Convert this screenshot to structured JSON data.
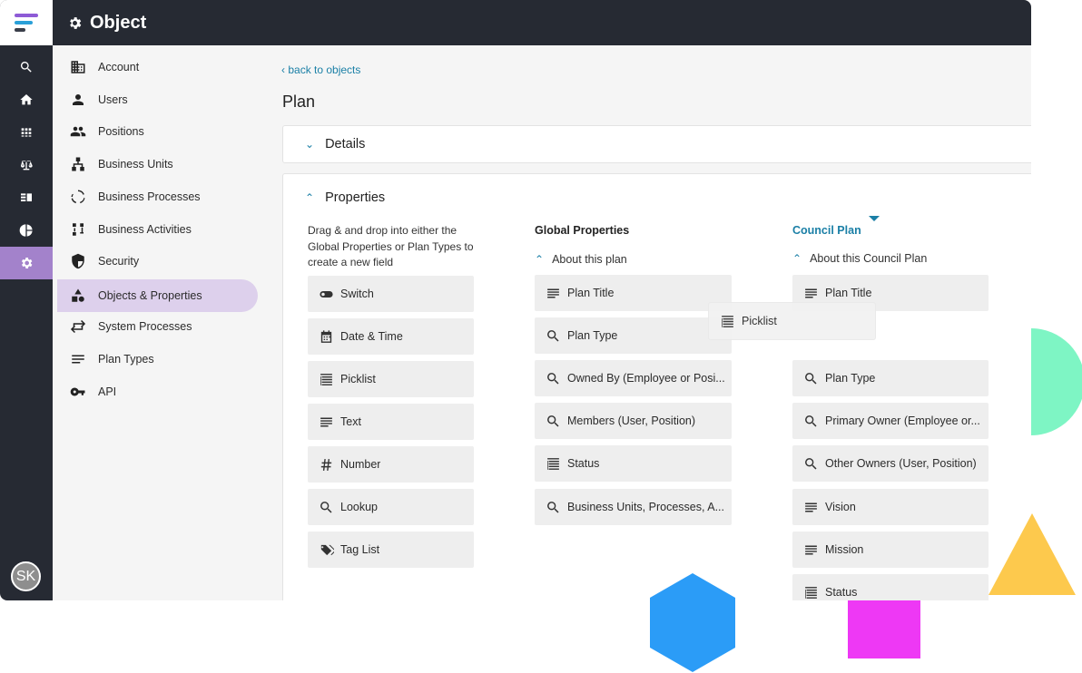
{
  "app": {
    "title": "Object",
    "user_initials": "SK"
  },
  "rail": [
    "search-icon",
    "home-icon",
    "grid-icon",
    "scale-icon",
    "board-icon",
    "pie-icon",
    "gear-icon"
  ],
  "sidebar": {
    "items": [
      {
        "label": "Account",
        "icon": "building-icon"
      },
      {
        "label": "Users",
        "icon": "user-icon"
      },
      {
        "label": "Positions",
        "icon": "people-icon"
      },
      {
        "label": "Business Units",
        "icon": "hierarchy-icon"
      },
      {
        "label": "Business Processes",
        "icon": "cycle-icon"
      },
      {
        "label": "Business Activities",
        "icon": "activities-icon"
      },
      {
        "label": "Security",
        "icon": "shield-icon"
      },
      {
        "label": "Objects & Properties",
        "icon": "shapes-icon",
        "active": true
      },
      {
        "label": "System Processes",
        "icon": "swap-icon"
      },
      {
        "label": "Plan Types",
        "icon": "lines-icon"
      },
      {
        "label": "API",
        "icon": "key-icon"
      }
    ]
  },
  "main": {
    "back_link": "back to objects",
    "page_title": "Plan",
    "details_label": "Details",
    "properties_label": "Properties",
    "drag_hint": "Drag & and drop into either the Global Properties or Plan Types to create a new field",
    "field_types": [
      {
        "label": "Switch",
        "icon": "toggle-icon"
      },
      {
        "label": "Date & Time",
        "icon": "calendar-icon"
      },
      {
        "label": "Picklist",
        "icon": "picklist-icon"
      },
      {
        "label": "Text",
        "icon": "text-icon"
      },
      {
        "label": "Number",
        "icon": "hash-icon"
      },
      {
        "label": "Lookup",
        "icon": "search-icon"
      },
      {
        "label": "Tag List",
        "icon": "tags-icon"
      }
    ],
    "global": {
      "title": "Global Properties",
      "section": "About this plan",
      "items": [
        {
          "label": "Plan Title",
          "icon": "text-icon"
        },
        {
          "label": "Plan Type",
          "icon": "search-icon"
        },
        {
          "label": "Owned By (Employee or Posi...",
          "icon": "search-icon"
        },
        {
          "label": "Members (User, Position)",
          "icon": "search-icon"
        },
        {
          "label": "Status",
          "icon": "picklist-icon"
        },
        {
          "label": "Business Units, Processes, A...",
          "icon": "search-icon"
        }
      ]
    },
    "council": {
      "title": "Council Plan",
      "section": "About this Council Plan",
      "items": [
        {
          "label": "Plan Title",
          "icon": "text-icon"
        },
        {
          "label": "Plan Type",
          "icon": "search-icon"
        },
        {
          "label": "Primary Owner (Employee or...",
          "icon": "search-icon"
        },
        {
          "label": "Other Owners (User, Position)",
          "icon": "search-icon"
        },
        {
          "label": "Vision",
          "icon": "text-icon"
        },
        {
          "label": "Mission",
          "icon": "text-icon"
        },
        {
          "label": "Status",
          "icon": "picklist-icon"
        }
      ]
    },
    "dragging": {
      "label": "Picklist",
      "icon": "picklist-icon"
    }
  },
  "colors": {
    "dark": "#262a33",
    "accent_purple": "#a382cb",
    "link_blue": "#1a7fa6",
    "deco_mint": "#7ef5c4",
    "deco_yellow": "#fdc94d",
    "deco_blue": "#2b9cf7",
    "deco_magenta": "#ee38f5"
  }
}
